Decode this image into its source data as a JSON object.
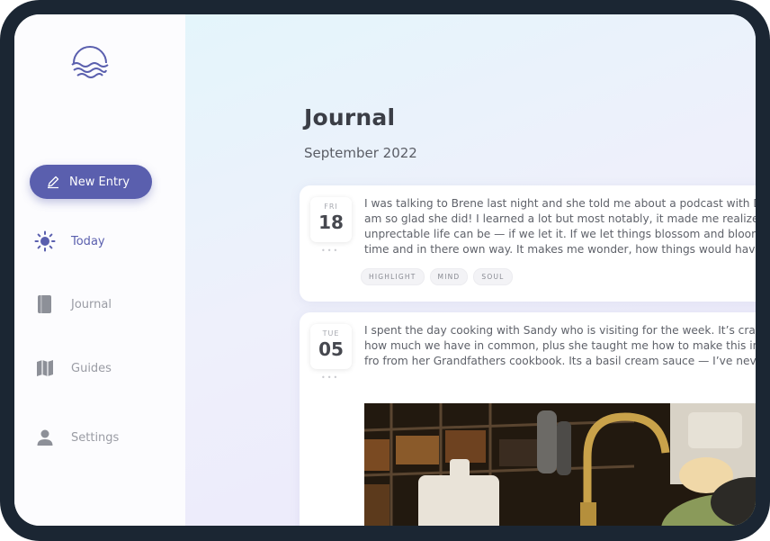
{
  "sidebar": {
    "new_entry_label": "New Entry",
    "items": [
      {
        "label": "Today"
      },
      {
        "label": "Journal"
      },
      {
        "label": "Guides"
      },
      {
        "label": "Settings"
      }
    ]
  },
  "main": {
    "title": "Journal",
    "subtitle": "September 2022",
    "entries": [
      {
        "dow": "FRI",
        "day": "18",
        "lines": [
          "I was talking to Brene last night and she told me about a podcast with D",
          "am so glad she did! I learned a lot but most notably, it made me realize h",
          "unprectable life can be — if we let it. If we let things blossom and bloom",
          "time and in there own way. It makes me wonder, how things would have"
        ],
        "tags": [
          "HIGHLIGHT",
          "MIND",
          "SOUL"
        ]
      },
      {
        "dow": "TUE",
        "day": "05",
        "lines": [
          "I spent the day cooking with Sandy who is visiting for the week. It’s craz",
          "how much we have in common, plus she taught me how to make this in",
          "fro from her Grandfathers cookbook. Its a basil cream sauce — I’ve neve"
        ]
      }
    ]
  },
  "colors": {
    "accent": "#5a5fae",
    "frame": "#1b2633"
  },
  "icons": {
    "logo": "sun-over-waves-logo",
    "new_entry": "pen-icon",
    "today": "sun-icon",
    "journal": "book-icon",
    "guides": "map-icon",
    "settings": "person-icon"
  }
}
